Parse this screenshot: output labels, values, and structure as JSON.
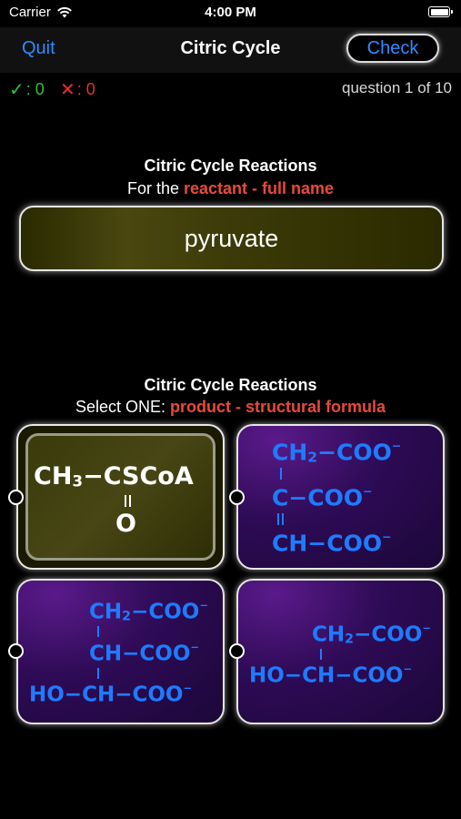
{
  "status_bar": {
    "carrier": "Carrier",
    "time": "4:00 PM"
  },
  "nav": {
    "quit_label": "Quit",
    "title": "Citric Cycle",
    "check_label": "Check"
  },
  "score": {
    "correct": ": 0",
    "wrong": ": 0",
    "question_counter": "question 1 of 10"
  },
  "reactant_section": {
    "title": "Citric Cycle Reactions",
    "prompt_prefix": "For the ",
    "prompt_highlight": "reactant - full name",
    "value": "pyruvate"
  },
  "product_section": {
    "title": "Citric Cycle Reactions",
    "prompt_prefix": "Select ONE: ",
    "prompt_highlight": "product - structural formula"
  },
  "options": [
    {
      "selected": true,
      "lines": [
        "CH3−CSCoA",
        "O"
      ]
    },
    {
      "selected": false,
      "lines": [
        "CH2−COO-",
        "C−COO-",
        "CH−COO-"
      ]
    },
    {
      "selected": false,
      "lines": [
        "CH2−COO-",
        "CH−COO-",
        "HO−CH−COO-"
      ]
    },
    {
      "selected": false,
      "lines": [
        "CH2−COO-",
        "HO−CH−COO-"
      ]
    }
  ],
  "colors": {
    "accent": "#2f8bff",
    "highlight": "#e84a3c",
    "correct": "#2ec33a",
    "wrong": "#e53030",
    "formula": "#1e7bff"
  }
}
